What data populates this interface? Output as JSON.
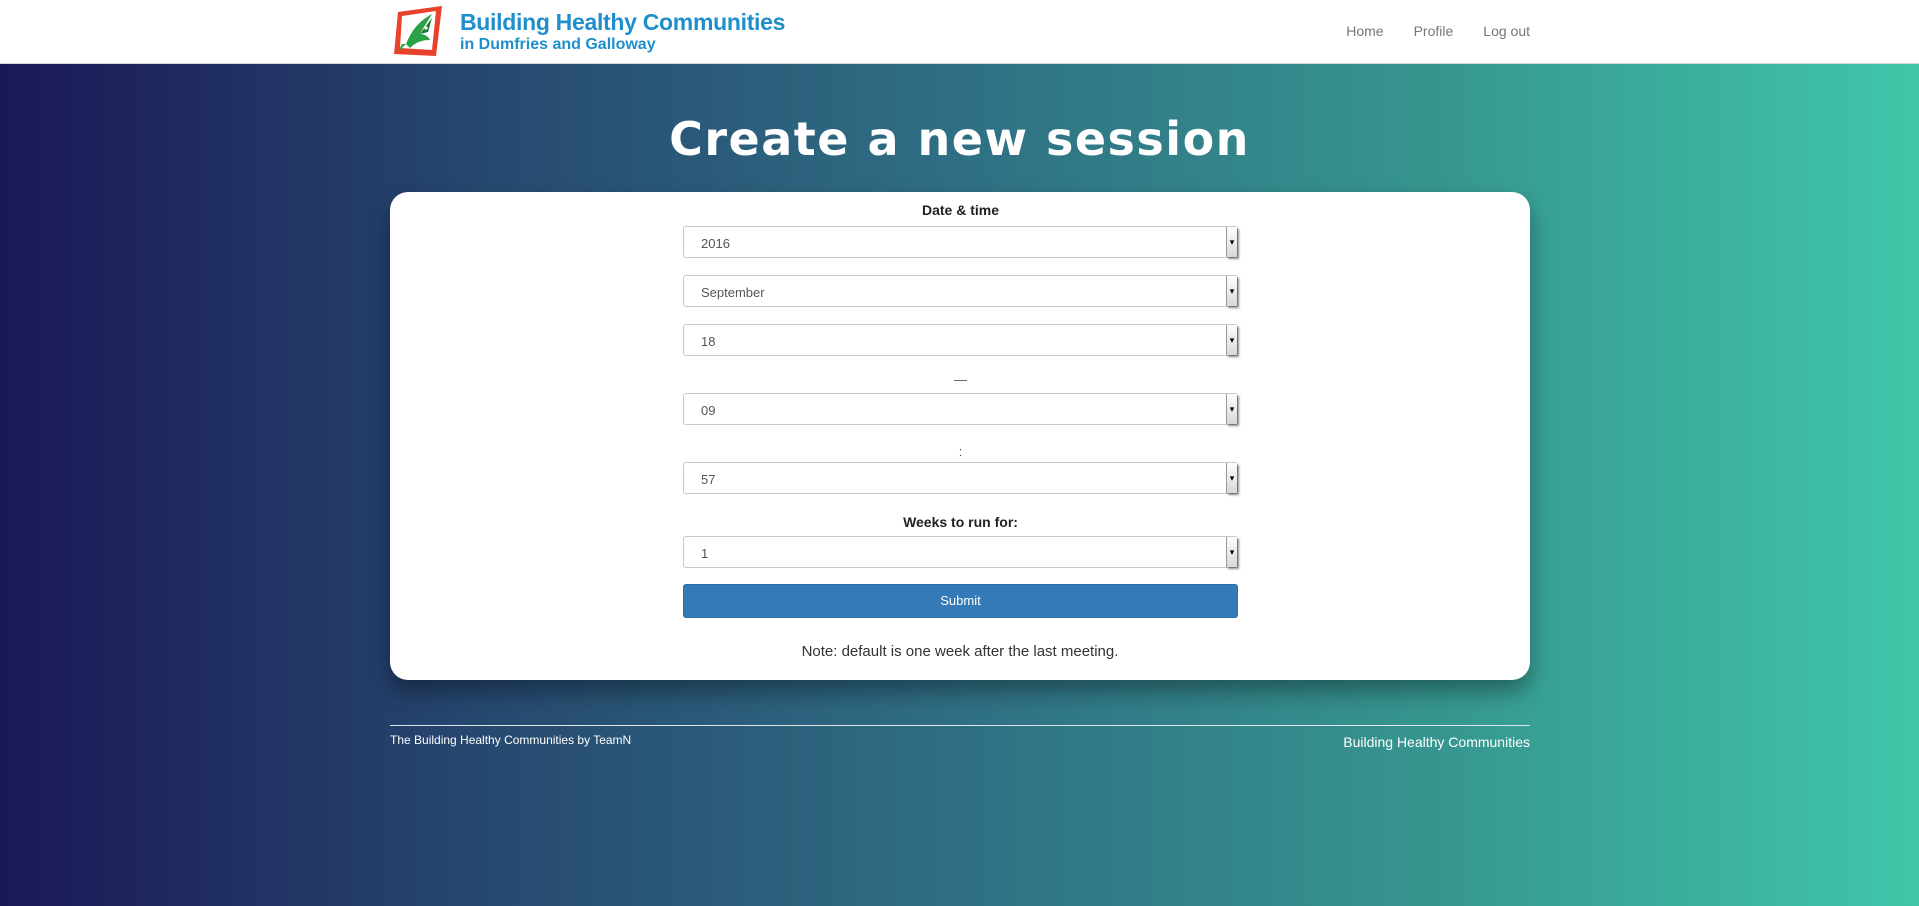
{
  "brand": {
    "title": "Building Healthy Communities",
    "subtitle": "in Dumfries and Galloway",
    "logo_icon": "hummingbird-logo-icon"
  },
  "nav": {
    "items": [
      {
        "label": "Home"
      },
      {
        "label": "Profile"
      },
      {
        "label": "Log out"
      }
    ]
  },
  "page": {
    "title": "Create a new session"
  },
  "form": {
    "datetime_label": "Date & time",
    "year": "2016",
    "month": "September",
    "day": "18",
    "time_separator": "—",
    "hour": "09",
    "minute_separator": ":",
    "minute": "57",
    "weeks_label": "Weeks to run for:",
    "weeks": "1",
    "submit_label": "Submit",
    "note": "Note: default is one week after the last meeting."
  },
  "footer": {
    "left": "The Building Healthy Communities by TeamN",
    "right": "Building Healthy Communities"
  },
  "colors": {
    "brand_blue": "#1f8fcb",
    "submit_blue": "#337ab7",
    "gradient_start": "#1b1856",
    "gradient_end": "#40c6a9"
  }
}
